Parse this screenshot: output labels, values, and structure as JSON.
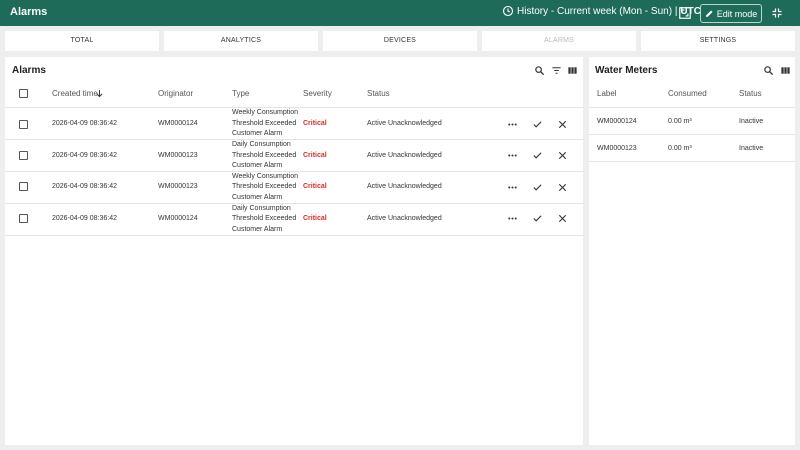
{
  "header": {
    "title": "Alarms",
    "history_label": "History - Current week (Mon - Sun) |",
    "timezone": "UTC",
    "edit_mode_label": "Edit mode"
  },
  "tabs": [
    {
      "label": "TOTAL",
      "disabled": false
    },
    {
      "label": "ANALYTICS",
      "disabled": false
    },
    {
      "label": "DEVICES",
      "disabled": false
    },
    {
      "label": "ALARMS",
      "disabled": true
    },
    {
      "label": "SETTINGS",
      "disabled": false
    }
  ],
  "alarms": {
    "title": "Alarms",
    "columns": {
      "created_time": "Created time",
      "originator": "Originator",
      "type": "Type",
      "severity": "Severity",
      "status": "Status"
    },
    "rows": [
      {
        "created": "2026-04-09 08:36:42",
        "originator": "WM0000124",
        "type": [
          "Weekly Consumption",
          "Threshold Exceeded",
          "Customer Alarm"
        ],
        "severity": "Critical",
        "status": "Active Unacknowledged"
      },
      {
        "created": "2026-04-09 08:36:42",
        "originator": "WM0000123",
        "type": [
          "Daily Consumption",
          "Threshold Exceeded",
          "Customer Alarm"
        ],
        "severity": "Critical",
        "status": "Active Unacknowledged"
      },
      {
        "created": "2026-04-09 08:36:42",
        "originator": "WM0000123",
        "type": [
          "Weekly Consumption",
          "Threshold Exceeded",
          "Customer Alarm"
        ],
        "severity": "Critical",
        "status": "Active Unacknowledged"
      },
      {
        "created": "2026-04-09 08:36:42",
        "originator": "WM0000124",
        "type": [
          "Daily Consumption",
          "Threshold Exceeded",
          "Customer Alarm"
        ],
        "severity": "Critical",
        "status": "Active Unacknowledged"
      }
    ]
  },
  "meters": {
    "title": "Water Meters",
    "columns": {
      "label": "Label",
      "consumed": "Consumed",
      "status": "Status"
    },
    "rows": [
      {
        "label": "WM0000124",
        "consumed": "0.00 m³",
        "status": "Inactive"
      },
      {
        "label": "WM0000123",
        "consumed": "0.00 m³",
        "status": "Inactive"
      }
    ]
  },
  "colors": {
    "header_bg": "#1f6b5a",
    "critical": "#d32f2f"
  },
  "icons": [
    "clock-icon",
    "fullscreen-icon",
    "pencil-icon",
    "exit-fullscreen-icon",
    "search-icon",
    "filter-icon",
    "columns-icon",
    "sort-desc-icon",
    "more-icon",
    "check-icon",
    "close-icon"
  ]
}
